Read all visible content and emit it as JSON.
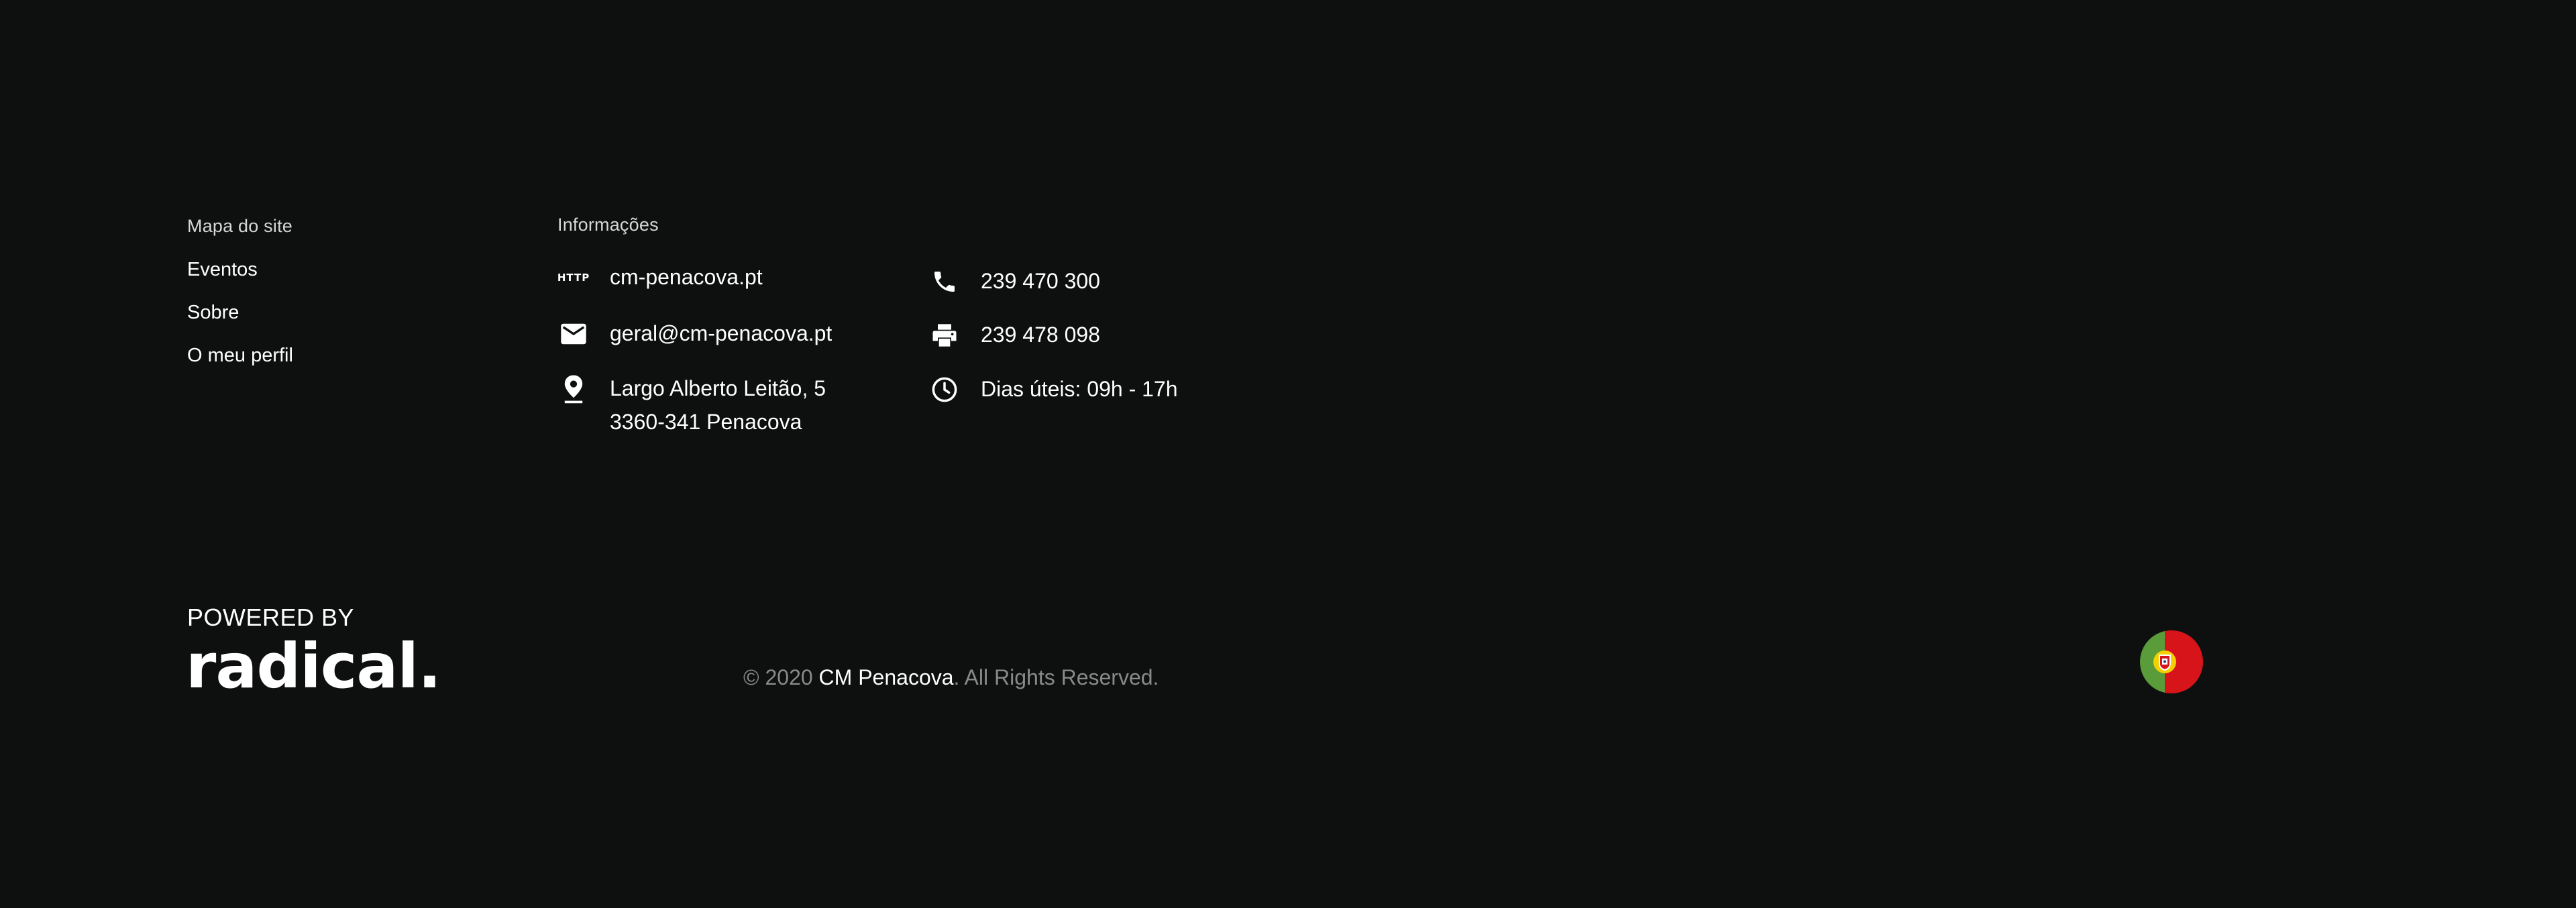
{
  "sitemap": {
    "title": "Mapa do site",
    "links": [
      "Eventos",
      "Sobre",
      "O meu perfil"
    ]
  },
  "info": {
    "title": "Informações",
    "website": {
      "icon": "http-icon",
      "label": "HTTP",
      "text": "cm-penacova.pt"
    },
    "email": {
      "icon": "mail-icon",
      "text": "geral@cm-penacova.pt"
    },
    "address": {
      "icon": "location-pin-icon",
      "line1": "Largo Alberto Leitão, 5",
      "line2": "3360-341 Penacova"
    },
    "phone": {
      "icon": "phone-icon",
      "text": "239 470 300"
    },
    "fax": {
      "icon": "printer-icon",
      "text": "239 478 098"
    },
    "hours": {
      "icon": "clock-icon",
      "text": "Dias úteis: 09h - 17h"
    }
  },
  "footer": {
    "powered_by": "POWERED BY",
    "brand": "radical.",
    "copyright_prefix": "© 2020 ",
    "copyright_owner": "CM Penacova",
    "copyright_suffix": ". All Rights Reserved.",
    "language_flag": "portugal-flag-icon"
  },
  "colors": {
    "background": "#0e0f0f",
    "text": "#ffffff",
    "muted_text": "#8a8a8a",
    "flag_green": "#5a9b3a",
    "flag_red": "#d7141a",
    "flag_yellow": "#f5d000"
  }
}
